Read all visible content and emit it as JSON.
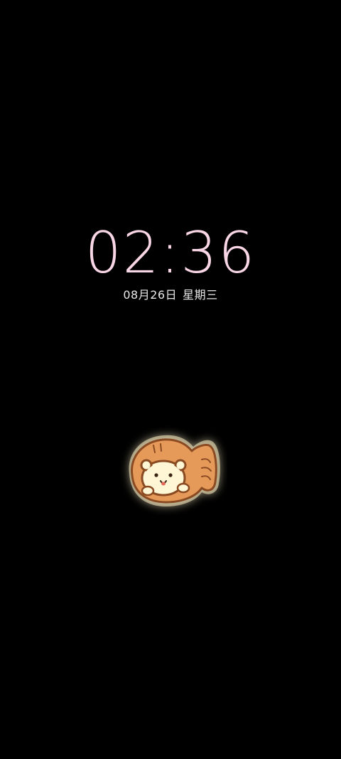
{
  "lockscreen": {
    "time": "02:36",
    "date": "08月26日",
    "weekday": "星期三"
  },
  "sticker": {
    "icon": "bear-taiyaki-sticker",
    "colors": {
      "glow": "#fff1c4",
      "fish_body": "#e69a5a",
      "fish_outline": "#8a4a22",
      "bear_face": "#fff6d6"
    }
  },
  "colors": {
    "background": "#000000",
    "clock": "#f8d6e6",
    "date": "#e8e8e8"
  }
}
